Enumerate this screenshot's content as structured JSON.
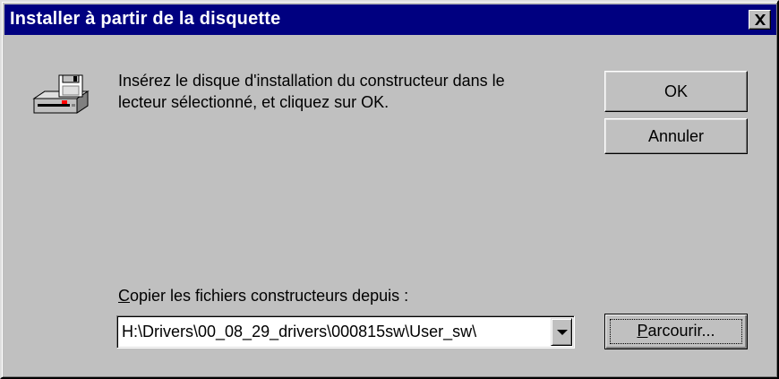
{
  "window": {
    "title": "Installer à partir de la disquette"
  },
  "icons": {
    "close": "close-icon",
    "disk": "floppy-drive-icon",
    "dropdown": "chevron-down-icon"
  },
  "message": "Insérez le disque d'installation du constructeur dans le\nlecteur sélectionné, et cliquez sur OK.",
  "buttons": {
    "ok": "OK",
    "cancel": "Annuler",
    "browse_mnemonic": "P",
    "browse_rest": "arcourir..."
  },
  "copy_from": {
    "label_mnemonic": "C",
    "label_rest": "opier les fichiers constructeurs depuis :",
    "value": "H:\\Drivers\\00_08_29_drivers\\000815sw\\User_sw\\"
  },
  "colors": {
    "titlebar": "#000080",
    "face": "#c0c0c0"
  }
}
